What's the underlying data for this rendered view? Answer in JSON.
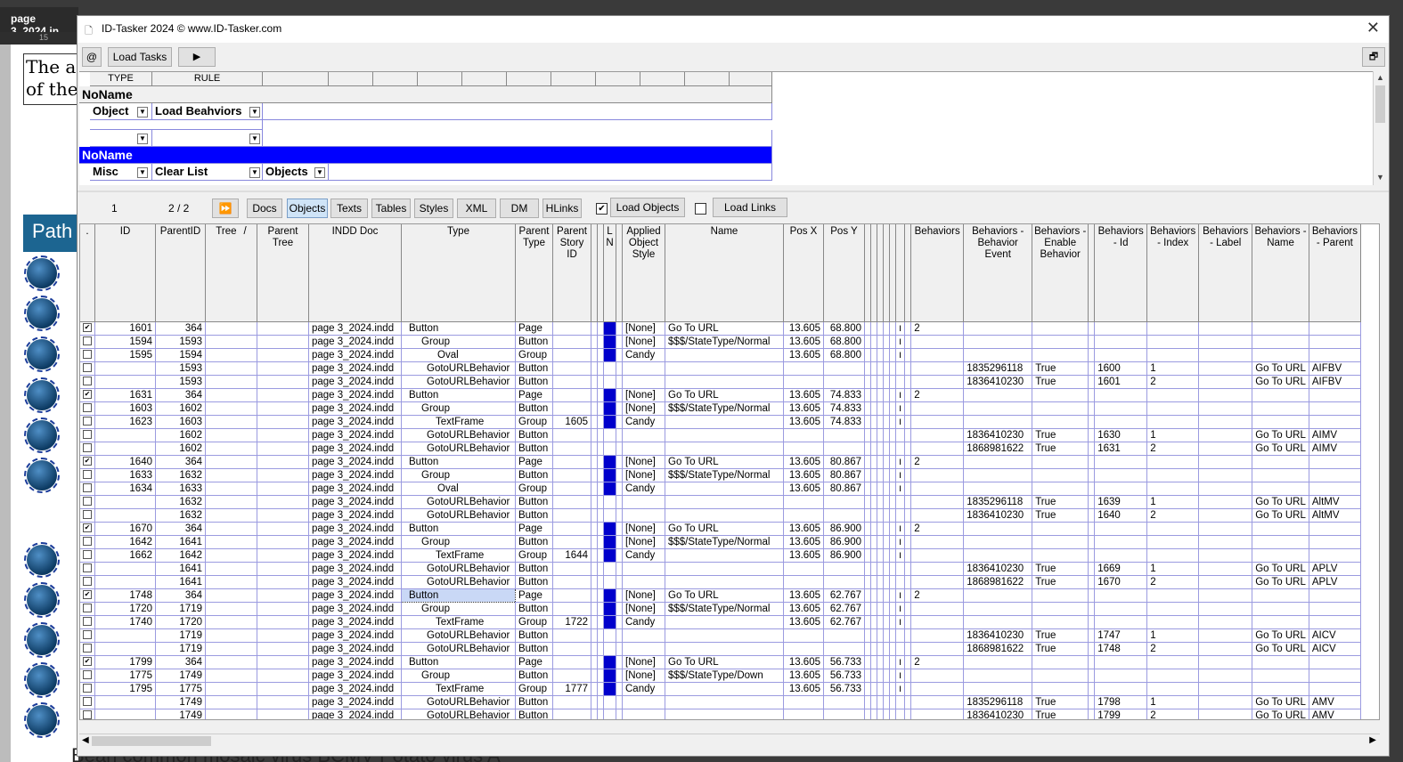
{
  "background": {
    "doc_tab": "page 3_2024.in",
    "ruler_mark": "15",
    "page_text": "The a\nof the",
    "banner_text": "Path",
    "footer_text": "Bean common mosaic virus        BCMV          Potato virus A"
  },
  "dialog": {
    "title": "ID-Tasker 2024  © www.ID-Tasker.com",
    "close": "✕",
    "toolbar": {
      "at_label": "@",
      "load_tasks": "Load Tasks",
      "play": "▶",
      "restore": "🗗"
    },
    "upper_grid": {
      "headers": [
        "TYPE",
        "RULE"
      ],
      "group1_title": "NoName",
      "group1_type": "Object",
      "group1_rule": "Load Beahviors",
      "group2_title": "NoName",
      "group2_type": "Misc",
      "group2_rule": "Clear List",
      "group2_extra": "Objects"
    },
    "lower_toolbar": {
      "record": "1",
      "pages": "2 / 2",
      "ff": "⏩",
      "tabs": [
        "Docs",
        "Objects",
        "Texts",
        "Tables",
        "Styles",
        "XML",
        "DM",
        "HLinks"
      ],
      "active_tab": "Objects",
      "load_objects_checked": true,
      "load_objects": "Load Objects",
      "load_links_checked": false,
      "load_links": "Load Links"
    },
    "columns": [
      ".",
      "ID",
      "ParentID",
      "Tree",
      "Parent Tree",
      "INDD Doc",
      "Type",
      "Parent Type",
      "Parent Story ID",
      "",
      "",
      "L N",
      "",
      "Applied Object Style",
      "Name",
      "Pos X",
      "Pos Y",
      "",
      "",
      "",
      "",
      "",
      "",
      "",
      "Behaviors",
      "Behaviors - Behavior Event",
      "Behaviors - Enable Behavior",
      "",
      "Behaviors - Id",
      "Behaviors - Index",
      "Behaviors - Label",
      "Behaviors - Name",
      "Behaviors - Parent"
    ],
    "tree_sort_mark": "/",
    "rows": [
      {
        "chk": true,
        "id": "1601",
        "pid": "364",
        "doc": "page 3_2024.indd",
        "type": "Button",
        "ptype": "Page",
        "psid": "",
        "ln": true,
        "style": "[None]",
        "name": "Go To URL",
        "x": "13.605",
        "y": "68.800",
        "ind": "ı",
        "beh": "2",
        "event": "",
        "enable": "",
        "bid": "",
        "bidx": "",
        "bname": "",
        "bparent": ""
      },
      {
        "chk": false,
        "id": "1594",
        "pid": "1593",
        "doc": "page 3_2024.indd",
        "type": "Group",
        "ptype": "Button",
        "psid": "",
        "ln": true,
        "style": "[None]",
        "name": "$$$/StateType/Normal",
        "x": "13.605",
        "y": "68.800",
        "ind": "ı",
        "beh": "",
        "event": "",
        "enable": "",
        "bid": "",
        "bidx": "",
        "bname": "",
        "bparent": ""
      },
      {
        "chk": false,
        "id": "1595",
        "pid": "1594",
        "doc": "page 3_2024.indd",
        "type": "Oval",
        "ptype": "Group",
        "psid": "",
        "ln": true,
        "style": "Candy",
        "name": "",
        "x": "13.605",
        "y": "68.800",
        "ind": "ı",
        "beh": "",
        "event": "",
        "enable": "",
        "bid": "",
        "bidx": "",
        "bname": "",
        "bparent": ""
      },
      {
        "chk": false,
        "id": "",
        "pid": "1593",
        "doc": "page 3_2024.indd",
        "type": "GotoURLBehavior",
        "ptype": "Button",
        "psid": "",
        "ln": false,
        "style": "",
        "name": "",
        "x": "",
        "y": "",
        "ind": "",
        "beh": "",
        "event": "1835296118",
        "enable": "True",
        "bid": "1600",
        "bidx": "1",
        "bname": "Go To URL",
        "bparent": "AIFBV"
      },
      {
        "chk": false,
        "id": "",
        "pid": "1593",
        "doc": "page 3_2024.indd",
        "type": "GotoURLBehavior",
        "ptype": "Button",
        "psid": "",
        "ln": false,
        "style": "",
        "name": "",
        "x": "",
        "y": "",
        "ind": "",
        "beh": "",
        "event": "1836410230",
        "enable": "True",
        "bid": "1601",
        "bidx": "2",
        "bname": "Go To URL",
        "bparent": "AIFBV"
      },
      {
        "chk": true,
        "id": "1631",
        "pid": "364",
        "doc": "page 3_2024.indd",
        "type": "Button",
        "ptype": "Page",
        "psid": "",
        "ln": true,
        "style": "[None]",
        "name": "Go To URL",
        "x": "13.605",
        "y": "74.833",
        "ind": "ı",
        "beh": "2",
        "event": "",
        "enable": "",
        "bid": "",
        "bidx": "",
        "bname": "",
        "bparent": ""
      },
      {
        "chk": false,
        "id": "1603",
        "pid": "1602",
        "doc": "page 3_2024.indd",
        "type": "Group",
        "ptype": "Button",
        "psid": "",
        "ln": true,
        "style": "[None]",
        "name": "$$$/StateType/Normal",
        "x": "13.605",
        "y": "74.833",
        "ind": "ı",
        "beh": "",
        "event": "",
        "enable": "",
        "bid": "",
        "bidx": "",
        "bname": "",
        "bparent": ""
      },
      {
        "chk": false,
        "id": "1623",
        "pid": "1603",
        "doc": "page 3_2024.indd",
        "type": "TextFrame",
        "ptype": "Group",
        "psid": "1605",
        "ln": true,
        "style": "Candy",
        "name": "",
        "x": "13.605",
        "y": "74.833",
        "ind": "ı",
        "beh": "",
        "event": "",
        "enable": "",
        "bid": "",
        "bidx": "",
        "bname": "",
        "bparent": ""
      },
      {
        "chk": false,
        "id": "",
        "pid": "1602",
        "doc": "page 3_2024.indd",
        "type": "GotoURLBehavior",
        "ptype": "Button",
        "psid": "",
        "ln": false,
        "style": "",
        "name": "",
        "x": "",
        "y": "",
        "ind": "",
        "beh": "",
        "event": "1836410230",
        "enable": "True",
        "bid": "1630",
        "bidx": "1",
        "bname": "Go To URL",
        "bparent": "AIMV"
      },
      {
        "chk": false,
        "id": "",
        "pid": "1602",
        "doc": "page 3_2024.indd",
        "type": "GotoURLBehavior",
        "ptype": "Button",
        "psid": "",
        "ln": false,
        "style": "",
        "name": "",
        "x": "",
        "y": "",
        "ind": "",
        "beh": "",
        "event": "1868981622",
        "enable": "True",
        "bid": "1631",
        "bidx": "2",
        "bname": "Go To URL",
        "bparent": "AIMV"
      },
      {
        "chk": true,
        "id": "1640",
        "pid": "364",
        "doc": "page 3_2024.indd",
        "type": "Button",
        "ptype": "Page",
        "psid": "",
        "ln": true,
        "style": "[None]",
        "name": "Go To URL",
        "x": "13.605",
        "y": "80.867",
        "ind": "ı",
        "beh": "2",
        "event": "",
        "enable": "",
        "bid": "",
        "bidx": "",
        "bname": "",
        "bparent": ""
      },
      {
        "chk": false,
        "id": "1633",
        "pid": "1632",
        "doc": "page 3_2024.indd",
        "type": "Group",
        "ptype": "Button",
        "psid": "",
        "ln": true,
        "style": "[None]",
        "name": "$$$/StateType/Normal",
        "x": "13.605",
        "y": "80.867",
        "ind": "ı",
        "beh": "",
        "event": "",
        "enable": "",
        "bid": "",
        "bidx": "",
        "bname": "",
        "bparent": ""
      },
      {
        "chk": false,
        "id": "1634",
        "pid": "1633",
        "doc": "page 3_2024.indd",
        "type": "Oval",
        "ptype": "Group",
        "psid": "",
        "ln": true,
        "style": "Candy",
        "name": "",
        "x": "13.605",
        "y": "80.867",
        "ind": "ı",
        "beh": "",
        "event": "",
        "enable": "",
        "bid": "",
        "bidx": "",
        "bname": "",
        "bparent": ""
      },
      {
        "chk": false,
        "id": "",
        "pid": "1632",
        "doc": "page 3_2024.indd",
        "type": "GotoURLBehavior",
        "ptype": "Button",
        "psid": "",
        "ln": false,
        "style": "",
        "name": "",
        "x": "",
        "y": "",
        "ind": "",
        "beh": "",
        "event": "1835296118",
        "enable": "True",
        "bid": "1639",
        "bidx": "1",
        "bname": "Go To URL",
        "bparent": "AltMV"
      },
      {
        "chk": false,
        "id": "",
        "pid": "1632",
        "doc": "page 3_2024.indd",
        "type": "GotoURLBehavior",
        "ptype": "Button",
        "psid": "",
        "ln": false,
        "style": "",
        "name": "",
        "x": "",
        "y": "",
        "ind": "",
        "beh": "",
        "event": "1836410230",
        "enable": "True",
        "bid": "1640",
        "bidx": "2",
        "bname": "Go To URL",
        "bparent": "AltMV"
      },
      {
        "chk": true,
        "id": "1670",
        "pid": "364",
        "doc": "page 3_2024.indd",
        "type": "Button",
        "ptype": "Page",
        "psid": "",
        "ln": true,
        "style": "[None]",
        "name": "Go To URL",
        "x": "13.605",
        "y": "86.900",
        "ind": "ı",
        "beh": "2",
        "event": "",
        "enable": "",
        "bid": "",
        "bidx": "",
        "bname": "",
        "bparent": ""
      },
      {
        "chk": false,
        "id": "1642",
        "pid": "1641",
        "doc": "page 3_2024.indd",
        "type": "Group",
        "ptype": "Button",
        "psid": "",
        "ln": true,
        "style": "[None]",
        "name": "$$$/StateType/Normal",
        "x": "13.605",
        "y": "86.900",
        "ind": "ı",
        "beh": "",
        "event": "",
        "enable": "",
        "bid": "",
        "bidx": "",
        "bname": "",
        "bparent": ""
      },
      {
        "chk": false,
        "id": "1662",
        "pid": "1642",
        "doc": "page 3_2024.indd",
        "type": "TextFrame",
        "ptype": "Group",
        "psid": "1644",
        "ln": true,
        "style": "Candy",
        "name": "",
        "x": "13.605",
        "y": "86.900",
        "ind": "ı",
        "beh": "",
        "event": "",
        "enable": "",
        "bid": "",
        "bidx": "",
        "bname": "",
        "bparent": ""
      },
      {
        "chk": false,
        "id": "",
        "pid": "1641",
        "doc": "page 3_2024.indd",
        "type": "GotoURLBehavior",
        "ptype": "Button",
        "psid": "",
        "ln": false,
        "style": "",
        "name": "",
        "x": "",
        "y": "",
        "ind": "",
        "beh": "",
        "event": "1836410230",
        "enable": "True",
        "bid": "1669",
        "bidx": "1",
        "bname": "Go To URL",
        "bparent": "APLV"
      },
      {
        "chk": false,
        "id": "",
        "pid": "1641",
        "doc": "page 3_2024.indd",
        "type": "GotoURLBehavior",
        "ptype": "Button",
        "psid": "",
        "ln": false,
        "style": "",
        "name": "",
        "x": "",
        "y": "",
        "ind": "",
        "beh": "",
        "event": "1868981622",
        "enable": "True",
        "bid": "1670",
        "bidx": "2",
        "bname": "Go To URL",
        "bparent": "APLV"
      },
      {
        "chk": true,
        "id": "1748",
        "pid": "364",
        "doc": "page 3_2024.indd",
        "type": "Button",
        "ptype": "Page",
        "psid": "",
        "ln": true,
        "style": "[None]",
        "name": "Go To URL",
        "x": "13.605",
        "y": "62.767",
        "ind": "ı",
        "beh": "2",
        "event": "",
        "enable": "",
        "bid": "",
        "bidx": "",
        "bname": "",
        "bparent": "",
        "selected": true
      },
      {
        "chk": false,
        "id": "1720",
        "pid": "1719",
        "doc": "page 3_2024.indd",
        "type": "Group",
        "ptype": "Button",
        "psid": "",
        "ln": true,
        "style": "[None]",
        "name": "$$$/StateType/Normal",
        "x": "13.605",
        "y": "62.767",
        "ind": "ı",
        "beh": "",
        "event": "",
        "enable": "",
        "bid": "",
        "bidx": "",
        "bname": "",
        "bparent": ""
      },
      {
        "chk": false,
        "id": "1740",
        "pid": "1720",
        "doc": "page 3_2024.indd",
        "type": "TextFrame",
        "ptype": "Group",
        "psid": "1722",
        "ln": true,
        "style": "Candy",
        "name": "",
        "x": "13.605",
        "y": "62.767",
        "ind": "ı",
        "beh": "",
        "event": "",
        "enable": "",
        "bid": "",
        "bidx": "",
        "bname": "",
        "bparent": ""
      },
      {
        "chk": false,
        "id": "",
        "pid": "1719",
        "doc": "page 3_2024.indd",
        "type": "GotoURLBehavior",
        "ptype": "Button",
        "psid": "",
        "ln": false,
        "style": "",
        "name": "",
        "x": "",
        "y": "",
        "ind": "",
        "beh": "",
        "event": "1836410230",
        "enable": "True",
        "bid": "1747",
        "bidx": "1",
        "bname": "Go To URL",
        "bparent": "AICV"
      },
      {
        "chk": false,
        "id": "",
        "pid": "1719",
        "doc": "page 3_2024.indd",
        "type": "GotoURLBehavior",
        "ptype": "Button",
        "psid": "",
        "ln": false,
        "style": "",
        "name": "",
        "x": "",
        "y": "",
        "ind": "",
        "beh": "",
        "event": "1868981622",
        "enable": "True",
        "bid": "1748",
        "bidx": "2",
        "bname": "Go To URL",
        "bparent": "AICV"
      },
      {
        "chk": true,
        "id": "1799",
        "pid": "364",
        "doc": "page 3_2024.indd",
        "type": "Button",
        "ptype": "Page",
        "psid": "",
        "ln": true,
        "style": "[None]",
        "name": "Go To URL",
        "x": "13.605",
        "y": "56.733",
        "ind": "ı",
        "beh": "2",
        "event": "",
        "enable": "",
        "bid": "",
        "bidx": "",
        "bname": "",
        "bparent": ""
      },
      {
        "chk": false,
        "id": "1775",
        "pid": "1749",
        "doc": "page 3_2024.indd",
        "type": "Group",
        "ptype": "Button",
        "psid": "",
        "ln": true,
        "style": "[None]",
        "name": "$$$/StateType/Down",
        "x": "13.605",
        "y": "56.733",
        "ind": "ı",
        "beh": "",
        "event": "",
        "enable": "",
        "bid": "",
        "bidx": "",
        "bname": "",
        "bparent": ""
      },
      {
        "chk": false,
        "id": "1795",
        "pid": "1775",
        "doc": "page 3_2024.indd",
        "type": "TextFrame",
        "ptype": "Group",
        "psid": "1777",
        "ln": true,
        "style": "Candy",
        "name": "",
        "x": "13.605",
        "y": "56.733",
        "ind": "ı",
        "beh": "",
        "event": "",
        "enable": "",
        "bid": "",
        "bidx": "",
        "bname": "",
        "bparent": ""
      },
      {
        "chk": false,
        "id": "",
        "pid": "1749",
        "doc": "page 3_2024.indd",
        "type": "GotoURLBehavior",
        "ptype": "Button",
        "psid": "",
        "ln": false,
        "style": "",
        "name": "",
        "x": "",
        "y": "",
        "ind": "",
        "beh": "",
        "event": "1835296118",
        "enable": "True",
        "bid": "1798",
        "bidx": "1",
        "bname": "Go To URL",
        "bparent": "AMV"
      },
      {
        "chk": false,
        "id": "",
        "pid": "1749",
        "doc": "page 3_2024.indd",
        "type": "GotoURLBehavior",
        "ptype": "Button",
        "psid": "",
        "ln": false,
        "style": "",
        "name": "",
        "x": "",
        "y": "",
        "ind": "",
        "beh": "",
        "event": "1836410230",
        "enable": "True",
        "bid": "1799",
        "bidx": "2",
        "bname": "Go To URL",
        "bparent": "AMV"
      }
    ],
    "colors": {
      "blue_marker": "#0000cc",
      "grid_line": "#9b9be0",
      "group_header": "#0000ff"
    }
  }
}
